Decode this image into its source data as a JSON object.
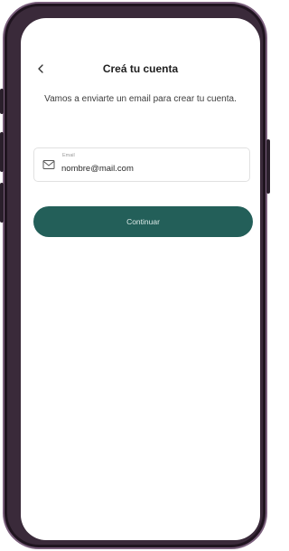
{
  "header": {
    "title": "Creá tu cuenta",
    "back_icon": "chevron-left-icon"
  },
  "subtitle": "Vamos a enviarte un email para crear tu cuenta.",
  "email_field": {
    "label": "Email",
    "value": "nombre@mail.com",
    "icon": "mail-icon"
  },
  "actions": {
    "continue_label": "Continuar"
  },
  "colors": {
    "primary": "#235f59",
    "frame": "#3a2a3a",
    "text": "#1e1e1e"
  }
}
